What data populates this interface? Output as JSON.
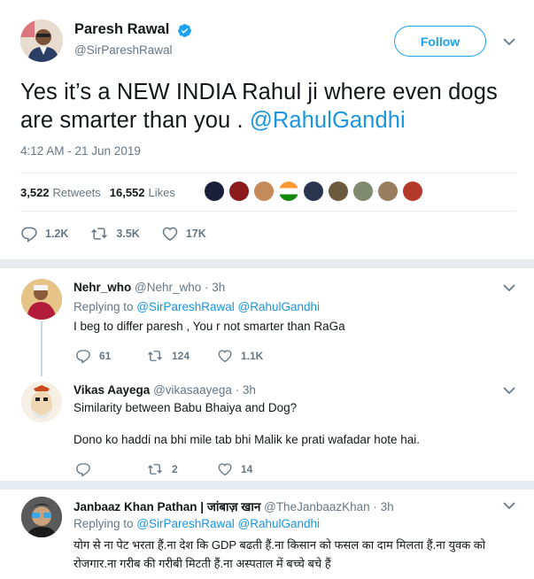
{
  "tweet": {
    "author_name": "Paresh Rawal",
    "author_handle": "@SirPareshRawal",
    "follow_label": "Follow",
    "text": "Yes it’s a NEW INDIA Rahul ji where even dogs are smarter than you . ",
    "mention": "@RahulGandhi",
    "timestamp": "4:12 AM - 21 Jun 2019",
    "retweets_count": "3,522",
    "retweets_label": "Retweets",
    "likes_count": "16,552",
    "likes_label": "Likes",
    "replies": "1.2K",
    "retweets_short": "3.5K",
    "likes_short": "17K"
  },
  "replies": [
    {
      "name": "Nehr_who",
      "handle": "@Nehr_who · 3h",
      "replying_prefix": "Replying to ",
      "replying_to": "@SirPareshRawal @RahulGandhi",
      "text": "I beg to differ paresh , You r not smarter than RaGa",
      "replies": "61",
      "retweets": "124",
      "likes": "1.1K"
    },
    {
      "name": "Vikas Aayega",
      "handle": "@vikasaayega · 3h",
      "text_1": "Similarity between Babu Bhaiya and Dog?",
      "text_2": "Dono ko haddi na bhi mile tab bhi Malik ke prati wafadar hote hai.",
      "replies": "",
      "retweets": "2",
      "likes": "14"
    },
    {
      "name": "Janbaaz Khan Pathan | जांबाज़ खान",
      "handle": "@TheJanbaazKhan · 3h",
      "replying_prefix": "Replying to ",
      "replying_to": "@SirPareshRawal @RahulGandhi",
      "text": "योग से ना पेट भरता हैं.ना देश कि GDP बढती हैं.ना किसान को फसल का दाम मिलता हैं.ना युवक को रोजगार.ना गरीब की गरीबी मिटती हैं.ना अस्पताल में बच्चे बचे हैं"
    }
  ],
  "colors": {
    "accent": "#1da1f2",
    "link": "#1b95e0",
    "muted": "#657786",
    "text": "#14171a",
    "divider": "#e6ecf0"
  },
  "icons": [
    "verified-badge-icon",
    "chevron-down-icon",
    "reply-icon",
    "retweet-icon",
    "like-icon"
  ]
}
